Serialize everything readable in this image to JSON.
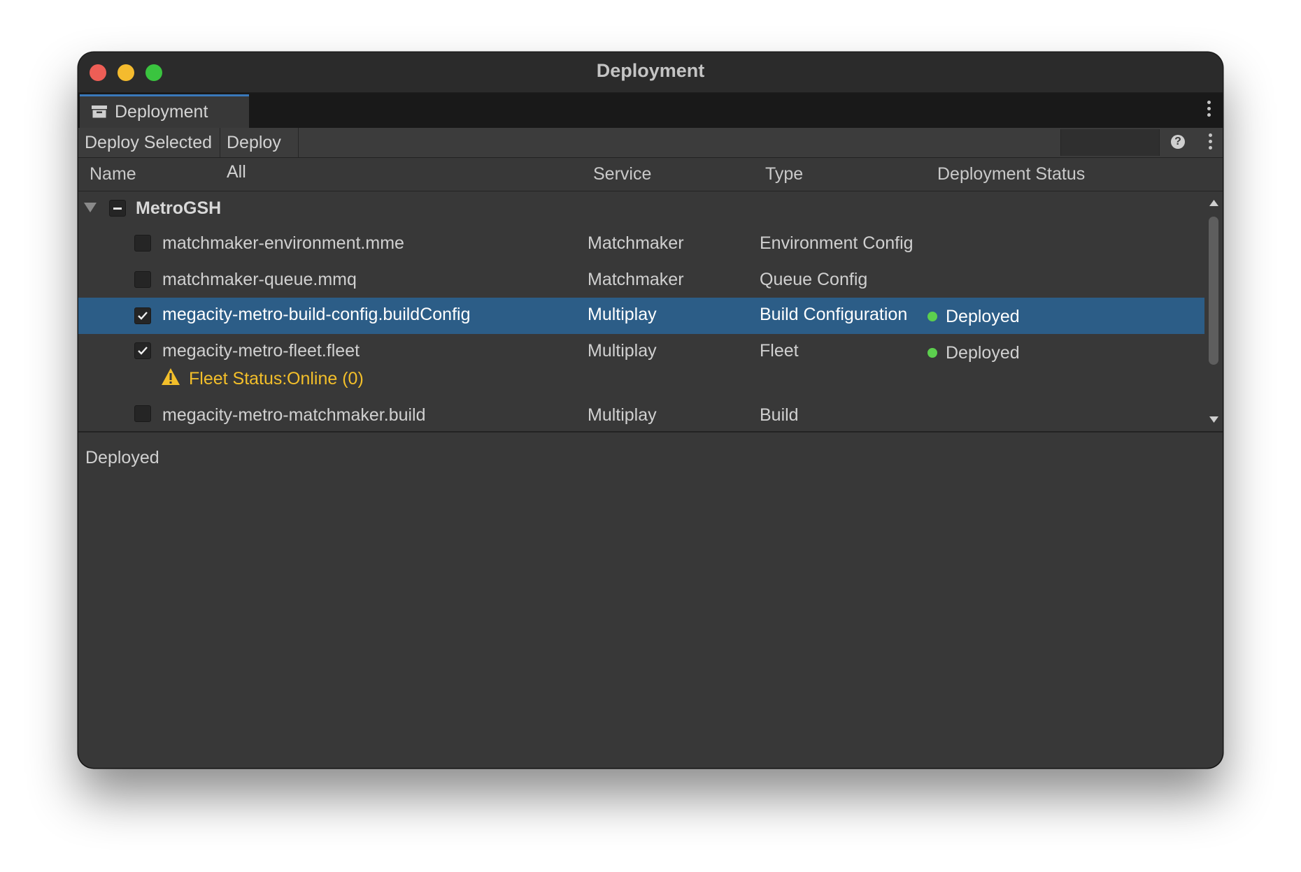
{
  "window": {
    "title": "Deployment"
  },
  "tab": {
    "label": "Deployment",
    "icon": "archive-box-icon"
  },
  "toolbar": {
    "deploy_selected": "Deploy Selected",
    "deploy_all": "Deploy All",
    "search_value": "",
    "help_icon": "question-circle-icon",
    "menu_icon": "more-vertical-icon"
  },
  "columns": {
    "name": "Name",
    "service": "Service",
    "type": "Type",
    "status": "Deployment Status"
  },
  "tree": {
    "group": {
      "name": "MetroGSH",
      "expanded": true,
      "check_state": "mixed"
    },
    "items": [
      {
        "name": "matchmaker-environment.mme",
        "service": "Matchmaker",
        "type": "Environment Config",
        "checked": false,
        "status": ""
      },
      {
        "name": "matchmaker-queue.mmq",
        "service": "Matchmaker",
        "type": "Queue Config",
        "checked": false,
        "status": ""
      },
      {
        "name": "megacity-metro-build-config.buildConfig",
        "service": "Multiplay",
        "type": "Build Configuration",
        "checked": true,
        "status": "Deployed",
        "selected": true
      },
      {
        "name": "megacity-metro-fleet.fleet",
        "service": "Multiplay",
        "type": "Fleet",
        "checked": true,
        "status": "Deployed",
        "warning_label": "Fleet Status:",
        "warning_value": "Online (0)"
      },
      {
        "name": "megacity-metro-matchmaker.build",
        "service": "Multiplay",
        "type": "Build",
        "checked": false,
        "status": ""
      }
    ]
  },
  "details": {
    "text": "Deployed"
  },
  "colors": {
    "selection": "#2c5d87",
    "status_ok": "#5ccf4e",
    "warning": "#f3bf2a",
    "tab_accent": "#3a79bb"
  }
}
